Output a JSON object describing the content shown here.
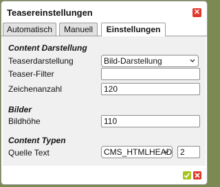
{
  "dialog": {
    "title": "Teasereinstellungen",
    "close_icon": "close-icon"
  },
  "tabs": [
    {
      "label": "Automatisch",
      "active": false
    },
    {
      "label": "Manuell",
      "active": false
    },
    {
      "label": "Einstellungen",
      "active": true
    }
  ],
  "sections": {
    "content_darstellung": {
      "heading": "Content Darstellung",
      "teaserdarstellung": {
        "label": "Teaserdarstellung",
        "value": "Bild-Darstellung"
      },
      "teaser_filter": {
        "label": "Teaser-Filter",
        "value": ""
      },
      "zeichenanzahl": {
        "label": "Zeichenanzahl",
        "value": "120"
      }
    },
    "bilder": {
      "heading": "Bilder",
      "bildhoehe": {
        "label": "Bildhöhe",
        "value": "110"
      }
    },
    "content_typen": {
      "heading": "Content Typen",
      "quelle_text": {
        "label": "Quelle Text",
        "type_value": "CMS_HTMLHEAD",
        "number_value": "2"
      }
    }
  },
  "footer": {
    "ok_icon": "check-icon",
    "cancel_icon": "close-icon"
  },
  "colors": {
    "accent_green": "#a6c51e",
    "accent_red": "#e2382d",
    "backdrop": "#7a8a52"
  }
}
